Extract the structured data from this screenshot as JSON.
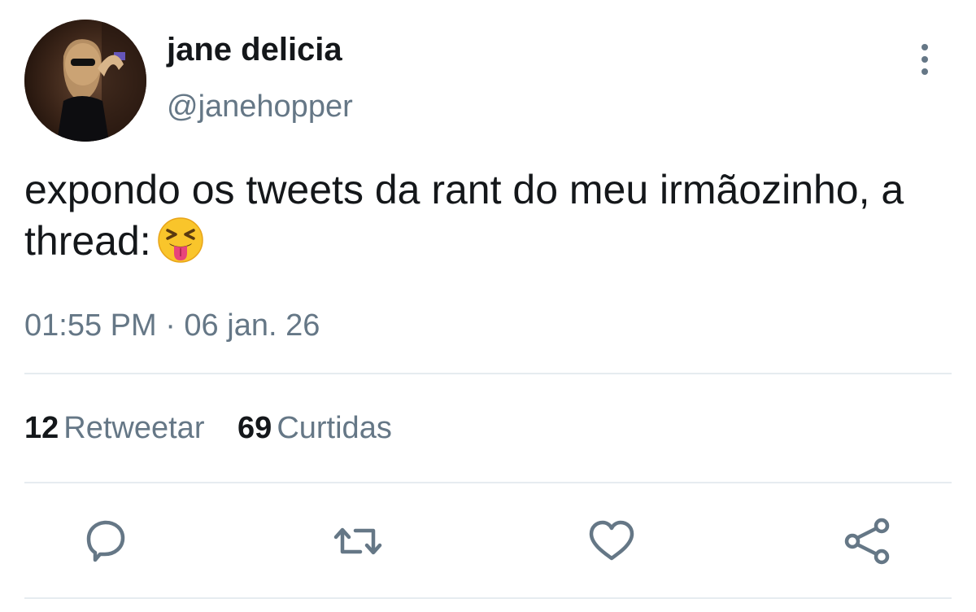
{
  "user": {
    "display_name": "jane delicia",
    "handle": "@janehopper"
  },
  "tweet": {
    "text": "expondo os tweets da rant do meu irmãozinho, a thread:",
    "emoji": "squinting-face-with-tongue",
    "timestamp": "01:55 PM · 06 jan. 26"
  },
  "stats": {
    "retweets_count": "12",
    "retweets_label": "Retweetar",
    "likes_count": "69",
    "likes_label": "Curtidas"
  },
  "actions": {
    "reply_icon": "reply-icon",
    "retweet_icon": "retweet-icon",
    "like_icon": "heart-icon",
    "share_icon": "share-icon"
  },
  "colors": {
    "text_primary": "#14171a",
    "text_secondary": "#657786",
    "divider": "#e6ecf0",
    "icon": "#657786"
  }
}
